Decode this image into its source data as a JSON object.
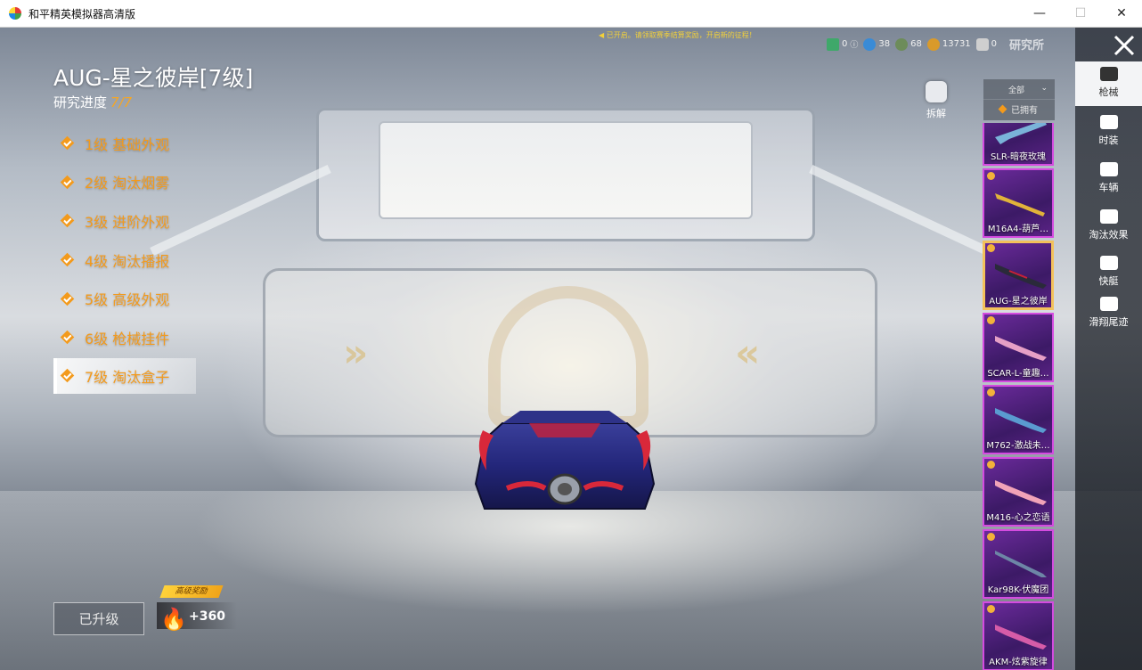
{
  "window": {
    "title": "和平精英模拟器高清版",
    "min": "—",
    "max": "☐",
    "close": "✕"
  },
  "weapon": {
    "title": "AUG-星之彼岸[7级]",
    "progress_label": "研究进度",
    "progress_value": "7/7"
  },
  "levels": [
    {
      "label": "1级 基础外观",
      "selected": false
    },
    {
      "label": "2级 淘汰烟雾",
      "selected": false
    },
    {
      "label": "3级 进阶外观",
      "selected": false
    },
    {
      "label": "4级 淘汰播报",
      "selected": false
    },
    {
      "label": "5级 高级外观",
      "selected": false
    },
    {
      "label": "6级 枪械挂件",
      "selected": false
    },
    {
      "label": "7级 淘汰盒子",
      "selected": true
    }
  ],
  "upgrade_button": "已升级",
  "reward": {
    "tag": "高级奖励",
    "count": "+360"
  },
  "notice": "已开启。请领取赛季结算奖励，开启新的征程！",
  "currencies": [
    {
      "icon": "ticket-icon",
      "value": "0",
      "color": "#3fa86a"
    },
    {
      "icon": "world-icon",
      "value": "38",
      "color": "#3a8bd6"
    },
    {
      "icon": "badge-icon",
      "value": "68",
      "color": "#6d8c5a"
    },
    {
      "icon": "coin-icon",
      "value": "13731",
      "color": "#d99a2b"
    },
    {
      "icon": "trophy-icon",
      "value": "0",
      "color": "#cfcfcf"
    }
  ],
  "lab_text": "研究所",
  "dismantle": "拆解",
  "filter": {
    "all": "全部",
    "owned": "已拥有"
  },
  "skins": [
    {
      "name": "SLR-暗夜玫瑰",
      "color": "#7ab3d9",
      "selected": false
    },
    {
      "name": "M16A4-葫芦…",
      "color": "#e1b33a",
      "selected": false
    },
    {
      "name": "AUG-星之彼岸",
      "color": "#2a2a3a",
      "selected": true
    },
    {
      "name": "SCAR-L-童趣…",
      "color": "#e6a0c6",
      "selected": false
    },
    {
      "name": "M762-激战未…",
      "color": "#5a9bd0",
      "selected": false
    },
    {
      "name": "M416-心之恋语",
      "color": "#f1a3b8",
      "selected": false
    },
    {
      "name": "Kar98K-伏魔团",
      "color": "#6d86a6",
      "selected": false
    },
    {
      "name": "AKM-炫紫旋律",
      "color": "#d65ca8",
      "selected": false
    }
  ],
  "categories": [
    {
      "label": "枪械",
      "icon": "gun-icon",
      "selected": true
    },
    {
      "label": "时装",
      "icon": "outfit-icon",
      "selected": false
    },
    {
      "label": "车辆",
      "icon": "car-icon",
      "selected": false
    },
    {
      "label": "淘汰效果",
      "icon": "elimination-effect-icon",
      "selected": false
    },
    {
      "label": "快艇",
      "icon": "boat-icon",
      "selected": false
    },
    {
      "label": "滑翔尾迹",
      "icon": "glider-trail-icon",
      "selected": false
    }
  ]
}
